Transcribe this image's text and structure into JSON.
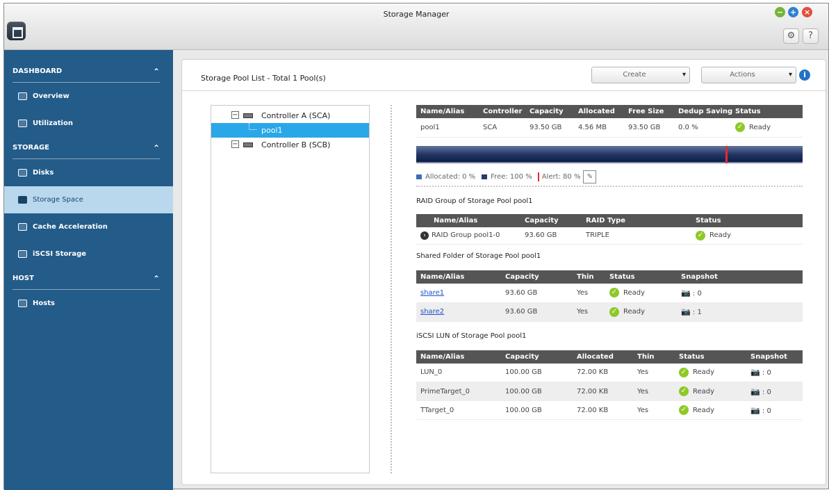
{
  "window": {
    "title": "Storage Manager",
    "controls": [
      "minimize-icon",
      "maximize-icon",
      "close-icon"
    ],
    "tools": [
      "gear-icon",
      "help-icon"
    ],
    "help_label": "?"
  },
  "sidebar": {
    "sections": [
      {
        "label": "DASHBOARD",
        "items": [
          {
            "label": "Overview",
            "icon": "overview-icon"
          },
          {
            "label": "Utilization",
            "icon": "utilization-icon"
          }
        ]
      },
      {
        "label": "STORAGE",
        "items": [
          {
            "label": "Disks",
            "icon": "disks-icon"
          },
          {
            "label": "Storage Space",
            "icon": "storage-space-icon",
            "active": true
          },
          {
            "label": "Cache Acceleration",
            "icon": "cache-icon"
          },
          {
            "label": "iSCSI Storage",
            "icon": "iscsi-icon"
          }
        ]
      },
      {
        "label": "HOST",
        "items": [
          {
            "label": "Hosts",
            "icon": "hosts-icon"
          }
        ]
      }
    ]
  },
  "main": {
    "title": "Storage Pool List - Total 1 Pool(s)",
    "create_label": "Create",
    "actions_label": "Actions",
    "info_icon": "i",
    "tree": {
      "controller_a": "Controller A (SCA)",
      "pool": "pool1",
      "controller_b": "Controller B (SCB)"
    },
    "pool_table": {
      "headers": [
        "Name/Alias",
        "Controller",
        "Capacity",
        "Allocated",
        "Free Size",
        "Dedup Saving",
        "Status"
      ],
      "row": [
        "pool1",
        "SCA",
        "93.50 GB",
        "4.56 MB",
        "93.50 GB",
        "0.0 %",
        "Ready"
      ]
    },
    "usage": {
      "allocated": "Allocated: 0 %",
      "free": "Free: 100 %",
      "alert": "Alert: 80 %",
      "alert_threshold": 0.8,
      "colors": {
        "allocated": "#3c6fb6",
        "free": "#2a386e",
        "alert": "#e22b2b"
      }
    },
    "raid": {
      "heading": "RAID Group of Storage Pool pool1",
      "headers": [
        "Name/Alias",
        "Capacity",
        "RAID Type",
        "Status"
      ],
      "row": [
        "RAID Group pool1-0",
        "93.60 GB",
        "TRIPLE",
        "Ready"
      ]
    },
    "shared": {
      "heading": "Shared Folder of Storage Pool pool1",
      "headers": [
        "Name/Alias",
        "Capacity",
        "Thin",
        "Status",
        "Snapshot"
      ],
      "rows": [
        [
          "share1",
          "93.60 GB",
          "Yes",
          "Ready",
          ": 0"
        ],
        [
          "share2",
          "93.60 GB",
          "Yes",
          "Ready",
          ": 1"
        ]
      ]
    },
    "lun": {
      "heading": "iSCSI LUN of Storage Pool pool1",
      "headers": [
        "Name/Alias",
        "Capacity",
        "Allocated",
        "Thin",
        "Status",
        "Snapshot"
      ],
      "rows": [
        [
          "LUN_0",
          "100.00 GB",
          "72.00 KB",
          "Yes",
          "Ready",
          ": 0"
        ],
        [
          "PrimeTarget_0",
          "100.00 GB",
          "72.00 KB",
          "Yes",
          "Ready",
          ": 0"
        ],
        [
          "TTarget_0",
          "100.00 GB",
          "72.00 KB",
          "Yes",
          "Ready",
          ": 0"
        ]
      ]
    }
  }
}
